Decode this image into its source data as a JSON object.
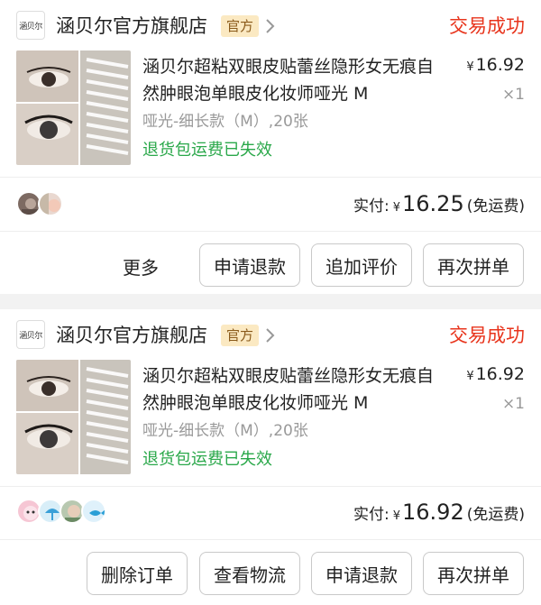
{
  "orders": [
    {
      "store": {
        "logo_text": "涵贝尔",
        "name": "涵贝尔官方旗舰店",
        "tag": "官方"
      },
      "status": "交易成功",
      "product": {
        "title": "涵贝尔超粘双眼皮贴蕾丝隐形女无痕自然肿眼泡单眼皮化妆师哑光 M",
        "price_symbol": "¥",
        "price": "16.92",
        "quantity": "×1",
        "sku": "哑光-细长款（M）,20张",
        "note": "退货包运费已失效"
      },
      "payment": {
        "label": "实付:",
        "symbol": "¥",
        "amount": "16.25",
        "shipping": "(免运费)"
      },
      "more_label": "更多",
      "buttons": [
        "申请退款",
        "追加评价",
        "再次拼单"
      ]
    },
    {
      "store": {
        "logo_text": "涵贝尔",
        "name": "涵贝尔官方旗舰店",
        "tag": "官方"
      },
      "status": "交易成功",
      "product": {
        "title": "涵贝尔超粘双眼皮贴蕾丝隐形女无痕自然肿眼泡单眼皮化妆师哑光 M",
        "price_symbol": "¥",
        "price": "16.92",
        "quantity": "×1",
        "sku": "哑光-细长款（M）,20张",
        "note": "退货包运费已失效"
      },
      "payment": {
        "label": "实付:",
        "symbol": "¥",
        "amount": "16.92",
        "shipping": "(免运费)"
      },
      "buttons": [
        "删除订单",
        "查看物流",
        "申请退款",
        "再次拼单"
      ]
    }
  ],
  "colors": {
    "status": "#e8341c",
    "note": "#2aa84a",
    "tag_bg": "#fbe9c2",
    "tag_text": "#8a5a1a",
    "muted": "#999999"
  }
}
